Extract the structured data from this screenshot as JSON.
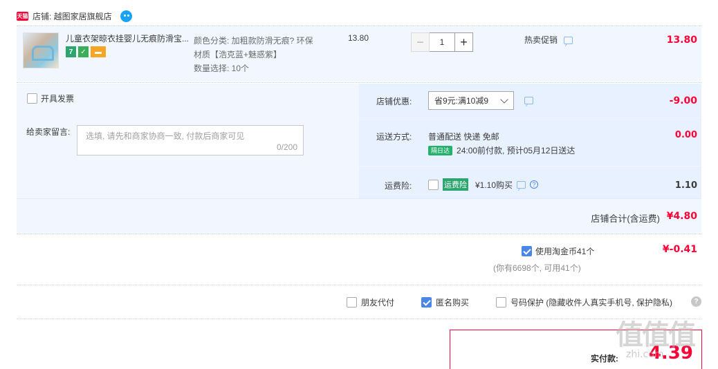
{
  "shop": {
    "tmall_badge": "天猫",
    "label": "店铺: 越图家居旗舰店"
  },
  "item": {
    "title": "儿童衣架晾衣挂婴儿无痕防滑宝...",
    "badge_seven": "7",
    "sku_line1": "颜色分类: 加粗款防滑无痕? 环保",
    "sku_line2": "材质【浩克蓝+魅惑紫】",
    "sku_line3": "数量选择: 10个",
    "unit_price": "13.80",
    "quantity": "1",
    "minus": "−",
    "plus": "+",
    "promo": "热卖促销",
    "total": "13.80"
  },
  "options": {
    "invoice_label": "开具发票",
    "memo_label": "给卖家留言:",
    "memo_placeholder": "选填, 请先和商家协商一致, 付款后商家可见",
    "memo_count": "0/200",
    "discount_label": "店铺优惠:",
    "discount_value": "省9元:满10减9",
    "discount_amount": "-9.00",
    "shipping_label": "运送方式:",
    "shipping_value": "普通配送 快递 免邮",
    "nextday_tag": "隔日达",
    "shipping_eta": "24:00前付款, 预计05月12日送达",
    "shipping_amount": "0.00",
    "insurance_label": "运费险:",
    "insurance_tag": "运费险",
    "insurance_price": "¥1.10购买",
    "insurance_amount": "1.10",
    "subtotal_label": "店铺合计(含运费)",
    "subtotal_amount": "¥4.80"
  },
  "coins": {
    "label": "使用淘金币41个",
    "amount": "¥-0.41",
    "note": "(你有6698个, 可用41个)"
  },
  "extras": {
    "friend_pay": "朋友代付",
    "anonymous": "匿名购买",
    "phone_protect": "号码保护 (隐藏收件人真实手机号, 保护隐私)"
  },
  "payment": {
    "label": "实付款:",
    "amount": "4.39"
  },
  "watermark": {
    "logo": "值值值",
    "sub": "zhi.com"
  },
  "colors": {
    "accent_red": "#ff0036",
    "row_blue": "#f2f7ff",
    "check_blue": "#4a86e8"
  }
}
